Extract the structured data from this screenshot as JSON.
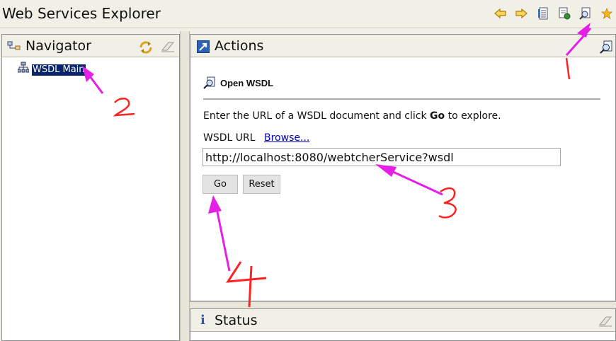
{
  "app": {
    "title": "Web Services Explorer"
  },
  "toolbar": {
    "icons": [
      "back-arrow-icon",
      "forward-arrow-icon",
      "favorites-list-icon",
      "uddi-page-icon",
      "wsdl-page-icon",
      "favorites-star-icon"
    ]
  },
  "navigator": {
    "title": "Navigator",
    "tree": [
      {
        "label": "WSDL Main",
        "selected": true
      }
    ]
  },
  "actions": {
    "title": "Actions",
    "section_title": "Open WSDL",
    "instruction_before": "Enter the URL of a WSDL document and click ",
    "instruction_bold": "Go",
    "instruction_after": " to explore.",
    "url_label": "WSDL URL",
    "browse_label": "Browse...",
    "url_value": "http://localhost:8080/webtcherService?wsdl",
    "go_label": "Go",
    "reset_label": "Reset"
  },
  "status": {
    "title": "Status"
  },
  "annotations": {
    "color": "#e61fe6",
    "number_color": "#ff2222",
    "numbers": [
      "1",
      "2",
      "3",
      "4"
    ]
  }
}
